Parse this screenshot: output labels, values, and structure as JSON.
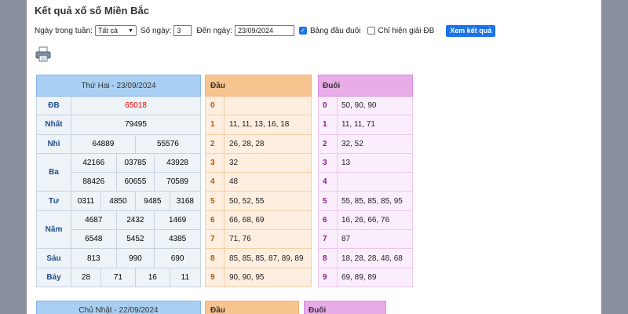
{
  "page_title": "Kết quả xổ số Miền Bắc",
  "filters": {
    "weekday_label": "Ngày trong tuần:",
    "weekday_value": "Tất cả",
    "days_label": "Số ngày:",
    "days_value": "3",
    "until_label": "Đến ngày:",
    "until_value": "23/09/2024",
    "head_table_label": "Bảng đầu đuôi",
    "head_table_checked": true,
    "special_only_label": "Chỉ hiện giải ĐB",
    "special_only_checked": false,
    "submit_label": "Xem kết quả"
  },
  "results": {
    "date_header": "Thứ Hai - 23/09/2024",
    "prizes": [
      {
        "label": "ĐB",
        "values": [
          "65018"
        ]
      },
      {
        "label": "Nhất",
        "values": [
          "79495"
        ]
      },
      {
        "label": "Nhì",
        "values": [
          "64889",
          "55576"
        ]
      },
      {
        "label": "Ba",
        "values": [
          "42166",
          "03785",
          "43928",
          "88426",
          "60655",
          "70589"
        ]
      },
      {
        "label": "Tư",
        "values": [
          "0311",
          "4850",
          "9485",
          "3168"
        ]
      },
      {
        "label": "Năm",
        "values": [
          "4687",
          "2432",
          "1469",
          "6548",
          "5452",
          "4385"
        ]
      },
      {
        "label": "Sáu",
        "values": [
          "813",
          "990",
          "690"
        ]
      },
      {
        "label": "Bảy",
        "values": [
          "28",
          "71",
          "16",
          "11"
        ]
      }
    ]
  },
  "head_table": {
    "header": "Đầu",
    "rows": [
      {
        "digit": "0",
        "values": ""
      },
      {
        "digit": "1",
        "values": "11, 11, 13, 16, 18"
      },
      {
        "digit": "2",
        "values": "26, 28, 28"
      },
      {
        "digit": "3",
        "values": "32"
      },
      {
        "digit": "4",
        "values": "48"
      },
      {
        "digit": "5",
        "values": "50, 52, 55"
      },
      {
        "digit": "6",
        "values": "66, 68, 69"
      },
      {
        "digit": "7",
        "values": "71, 76"
      },
      {
        "digit": "8",
        "values": "85, 85, 85, 87, 89, 89"
      },
      {
        "digit": "9",
        "values": "90, 90, 95"
      }
    ]
  },
  "tail_table": {
    "header": "Đuôi",
    "rows": [
      {
        "digit": "0",
        "values": "50, 90, 90"
      },
      {
        "digit": "1",
        "values": "11, 11, 71"
      },
      {
        "digit": "2",
        "values": "32, 52"
      },
      {
        "digit": "3",
        "values": "13"
      },
      {
        "digit": "4",
        "values": ""
      },
      {
        "digit": "5",
        "values": "55, 85, 85, 85, 95"
      },
      {
        "digit": "6",
        "values": "16, 26, 66, 76"
      },
      {
        "digit": "7",
        "values": "87"
      },
      {
        "digit": "8",
        "values": "18, 28, 28, 48, 68"
      },
      {
        "digit": "9",
        "values": "69, 89, 89"
      }
    ]
  },
  "next_day": {
    "date_header": "Chủ Nhật - 22/09/2024",
    "head_header": "Đầu",
    "tail_header": "Đuôi"
  },
  "colors": {
    "special_prize": "#e00000",
    "button": "#1a73e8",
    "main_header": "#a9cff3",
    "head_header": "#f7c48f",
    "tail_header": "#e8ade9"
  }
}
